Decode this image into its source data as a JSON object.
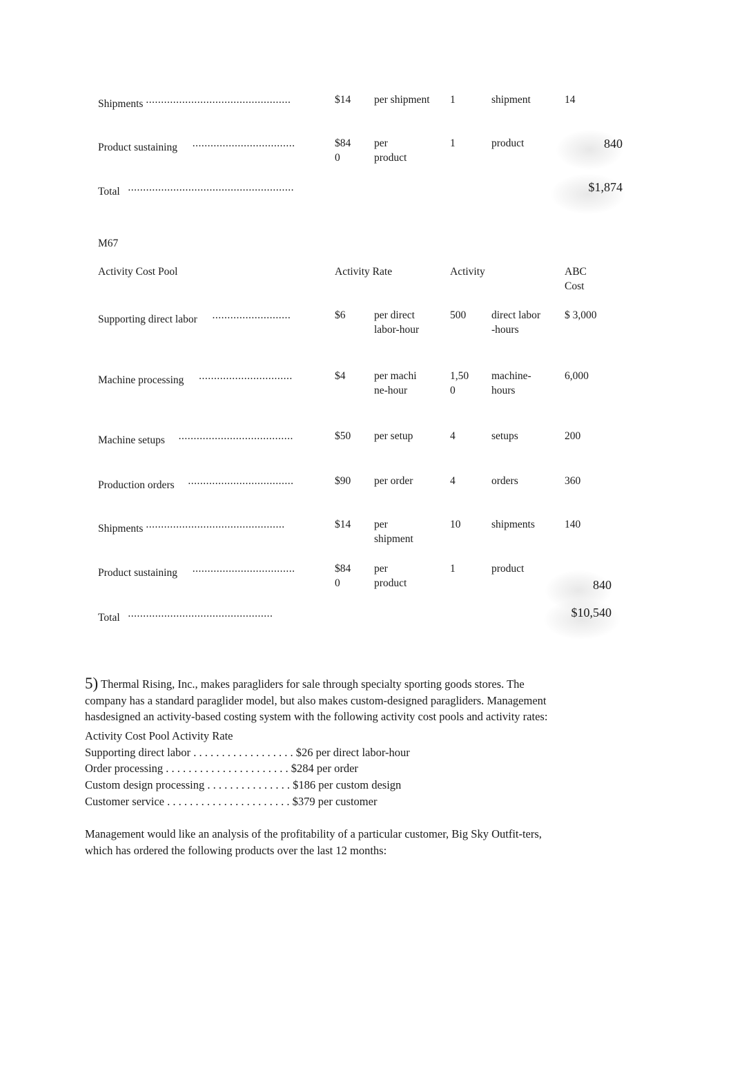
{
  "document": {
    "type": "accounting-worksheet",
    "background": "#ffffff",
    "text_color": "#1a1a1a"
  },
  "table_top": {
    "rows": [
      {
        "label": "Shipments",
        "leader": "................................................",
        "rate": "$14",
        "per": "per shipment",
        "activity": "1",
        "unit": "shipment",
        "cost": "14",
        "emphasis": false
      },
      {
        "label": "Product sustaining",
        "leader": "..................................",
        "rate": "$840",
        "per": "per product",
        "activity": "1",
        "unit": "product",
        "cost": "840",
        "emphasis": true
      }
    ],
    "total": {
      "label": "Total",
      "leader": ".......................................................",
      "cost": "$1,874"
    }
  },
  "section_m67": {
    "title": "M67",
    "headers": {
      "cost_pool": "Activity Cost Pool",
      "activity_rate": "Activity Rate",
      "activity": "Activity",
      "abc_cost": "ABC Cost"
    },
    "rows": [
      {
        "label": "Supporting direct labor",
        "leader": "..........................",
        "rate": "$6",
        "per": "per direct labor-hour",
        "activity": "500",
        "unit": "direct labor-hours",
        "cost": "$ 3,000",
        "emphasis": false
      },
      {
        "label": "Machine processing",
        "leader": "...............................",
        "rate": "$4",
        "per": "per machine-hour",
        "activity": "1,500",
        "unit": "machine-hours",
        "cost": "6,000",
        "emphasis": false
      },
      {
        "label": "Machine setups",
        "leader": "......................................",
        "rate": "$50",
        "per": "per setup",
        "activity": "4",
        "unit": "setups",
        "cost": "200",
        "emphasis": false
      },
      {
        "label": "Production orders",
        "leader": "...................................",
        "rate": "$90",
        "per": "per order",
        "activity": "4",
        "unit": "orders",
        "cost": "360",
        "emphasis": false
      },
      {
        "label": "Shipments",
        "leader": "..............................................",
        "rate": "$14",
        "per": "per shipment",
        "activity": "10",
        "unit": "shipments",
        "cost": "140",
        "emphasis": false
      },
      {
        "label": "Product sustaining",
        "leader": "..................................",
        "rate": "$840",
        "per": "per product",
        "activity": "1",
        "unit": "product",
        "cost": "840",
        "emphasis": true
      }
    ],
    "total": {
      "label": "Total",
      "leader": "................................................",
      "cost": "$10,540"
    }
  },
  "question5": {
    "number": "5)",
    "paragraph_1": "Thermal Rising, Inc., makes paragliders for sale through specialty sporting goods stores. The company has a standard paraglider model, but also makes custom-designed paragliders. Management hasdesigned an activity-based costing system with the following activity cost pools and activity rates:",
    "subheading": "Activity Cost Pool Activity Rate",
    "rate_list": [
      {
        "label": "Supporting direct labor",
        "leader": ". . . . . . . . . . . . . . . . . .",
        "value": "$26 per direct labor-hour"
      },
      {
        "label": "Order processing",
        "leader": ". . . . . . . . . . . . . . . . . . . . . .",
        "value": "$284 per order"
      },
      {
        "label": "Custom design processing",
        "leader": ". . . . . . . . . . . . . . .",
        "value": "$186 per custom design"
      },
      {
        "label": "Customer service",
        "leader": ". . . . . . . . . . . . . . . . . . . . . .",
        "value": "$379 per customer"
      }
    ],
    "paragraph_2": "Management would like an analysis of the profitability of a particular customer, Big Sky Outfit-ters, which has ordered the following products over the last 12 months:"
  }
}
